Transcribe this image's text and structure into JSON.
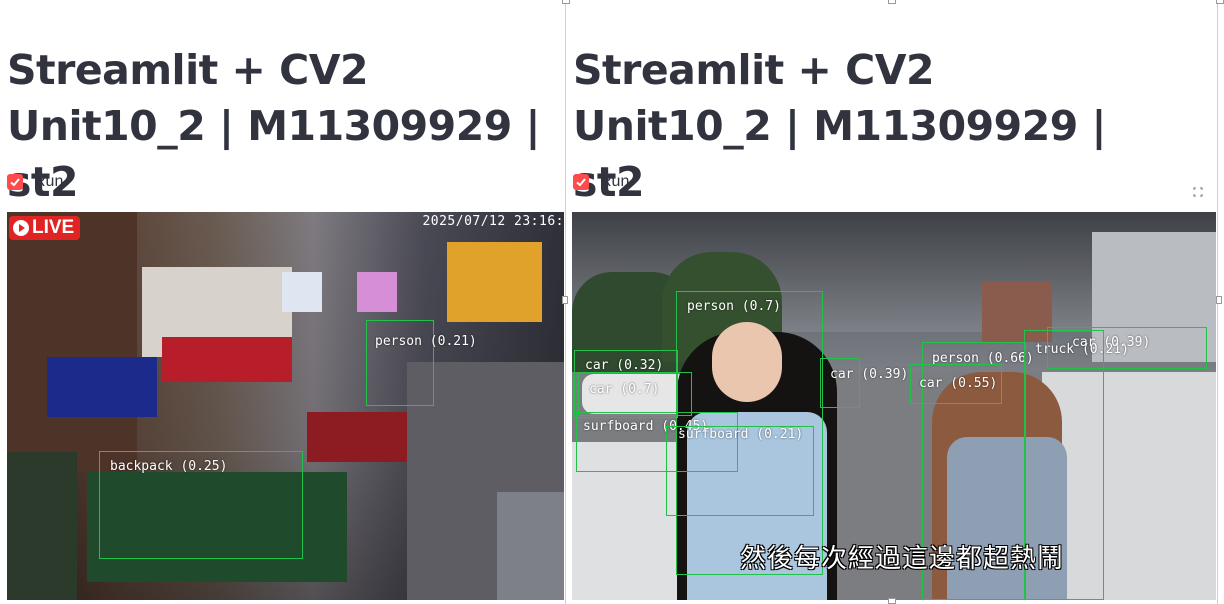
{
  "panels": {
    "left": {
      "title": "Streamlit + CV2 Unit10_2 | M11309929 | st2",
      "checkbox_label": "Run",
      "checkbox_checked": true,
      "overlay": {
        "live_badge": "LIVE",
        "timestamp": "2025/07/12 23:16:"
      },
      "detections": [
        {
          "label": "person (0.21)"
        },
        {
          "label": "backpack (0.25)"
        }
      ]
    },
    "right": {
      "title": "Streamlit + CV2 Unit10_2 | M11309929 | st2",
      "checkbox_label": "Run",
      "checkbox_checked": true,
      "overlay": {
        "subtitle": "然後每次經過這邊都超熱鬧"
      },
      "detections": [
        {
          "label": "person (0.7)"
        },
        {
          "label": "car (0.32)"
        },
        {
          "label": "car (0.7)"
        },
        {
          "label": "surfboard (0.45)"
        },
        {
          "label": "surfboard (0.21)"
        },
        {
          "label": "person (0.66)"
        },
        {
          "label": "car (0.55)"
        },
        {
          "label": "car (0.39)"
        },
        {
          "label": "truck (0.21)"
        },
        {
          "label": "car (0.39)"
        }
      ]
    }
  },
  "colors": {
    "accent": "#ff4b4b",
    "detection_box": "#22c24a",
    "title_text": "#31333f",
    "live_badge": "#e02424"
  },
  "icons": {
    "checkbox": "check-icon",
    "fullscreen": "fullscreen-icon",
    "live": "play-circle-icon"
  }
}
